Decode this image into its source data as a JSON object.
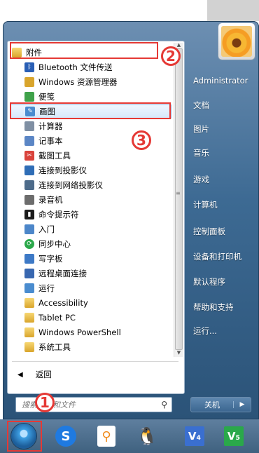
{
  "start_menu": {
    "programs": [
      {
        "label": "附件",
        "kind": "folder-open",
        "icon": "folder-icon"
      },
      {
        "label": "Bluetooth 文件传送",
        "kind": "sub",
        "icon": "bluetooth-icon",
        "color": "#2a5fb5"
      },
      {
        "label": "Windows 资源管理器",
        "kind": "sub",
        "icon": "explorer-icon",
        "color": "#d9a52c"
      },
      {
        "label": "便笺",
        "kind": "sub",
        "icon": "sticky-note-icon",
        "color": "#3fa24a"
      },
      {
        "label": "画图",
        "kind": "sub",
        "icon": "paint-icon",
        "color": "#4a8ccf"
      },
      {
        "label": "计算器",
        "kind": "sub",
        "icon": "calculator-icon",
        "color": "#7f8fa3"
      },
      {
        "label": "记事本",
        "kind": "sub",
        "icon": "notepad-icon",
        "color": "#5b86c5"
      },
      {
        "label": "截图工具",
        "kind": "sub",
        "icon": "snipping-tool-icon",
        "color": "#d9423b"
      },
      {
        "label": "连接到投影仪",
        "kind": "sub",
        "icon": "projector-icon",
        "color": "#2f6db6"
      },
      {
        "label": "连接到网络投影仪",
        "kind": "sub",
        "icon": "network-projector-icon",
        "color": "#4d6b8a"
      },
      {
        "label": "录音机",
        "kind": "sub",
        "icon": "microphone-icon",
        "color": "#6c6c6c"
      },
      {
        "label": "命令提示符",
        "kind": "sub",
        "icon": "command-prompt-icon",
        "color": "#1b1b1b"
      },
      {
        "label": "入门",
        "kind": "sub",
        "icon": "getting-started-icon",
        "color": "#4c86c9"
      },
      {
        "label": "同步中心",
        "kind": "sub",
        "icon": "sync-center-icon",
        "color": "#2aa84a"
      },
      {
        "label": "写字板",
        "kind": "sub",
        "icon": "wordpad-icon",
        "color": "#3d79c6"
      },
      {
        "label": "远程桌面连接",
        "kind": "sub",
        "icon": "remote-desktop-icon",
        "color": "#3867b0"
      },
      {
        "label": "运行",
        "kind": "sub",
        "icon": "run-icon",
        "color": "#4a8ccf"
      },
      {
        "label": "Accessibility",
        "kind": "subfolder",
        "icon": "folder-icon"
      },
      {
        "label": "Tablet PC",
        "kind": "subfolder",
        "icon": "folder-icon"
      },
      {
        "label": "Windows PowerShell",
        "kind": "subfolder",
        "icon": "folder-icon"
      },
      {
        "label": "系统工具",
        "kind": "subfolder",
        "icon": "folder-icon"
      }
    ],
    "back_label": "返回",
    "search_placeholder": "搜索程序和文件",
    "right_items": [
      "Administrator",
      "文档",
      "图片",
      "音乐",
      "游戏",
      "计算机",
      "控制面板",
      "设备和打印机",
      "默认程序",
      "帮助和支持",
      "运行..."
    ],
    "shutdown_label": "关机"
  },
  "taskbar": {
    "apps": [
      {
        "name": "start-orb",
        "icon": "windows-orb-icon"
      },
      {
        "name": "app-s",
        "icon": "sogou-icon",
        "glyph": "S"
      },
      {
        "name": "app-magnifier",
        "icon": "magnifier-document-icon",
        "glyph": "⚲"
      },
      {
        "name": "app-qq",
        "icon": "qq-penguin-icon",
        "glyph": "🐧"
      },
      {
        "name": "app-v4",
        "icon": "v4-icon",
        "glyph": "V₄"
      },
      {
        "name": "app-v5",
        "icon": "v5-icon",
        "glyph": "V₅"
      }
    ]
  },
  "annotations": {
    "badge1": "1",
    "badge2": "2",
    "badge3": "3",
    "accent_red": "#e53935"
  }
}
